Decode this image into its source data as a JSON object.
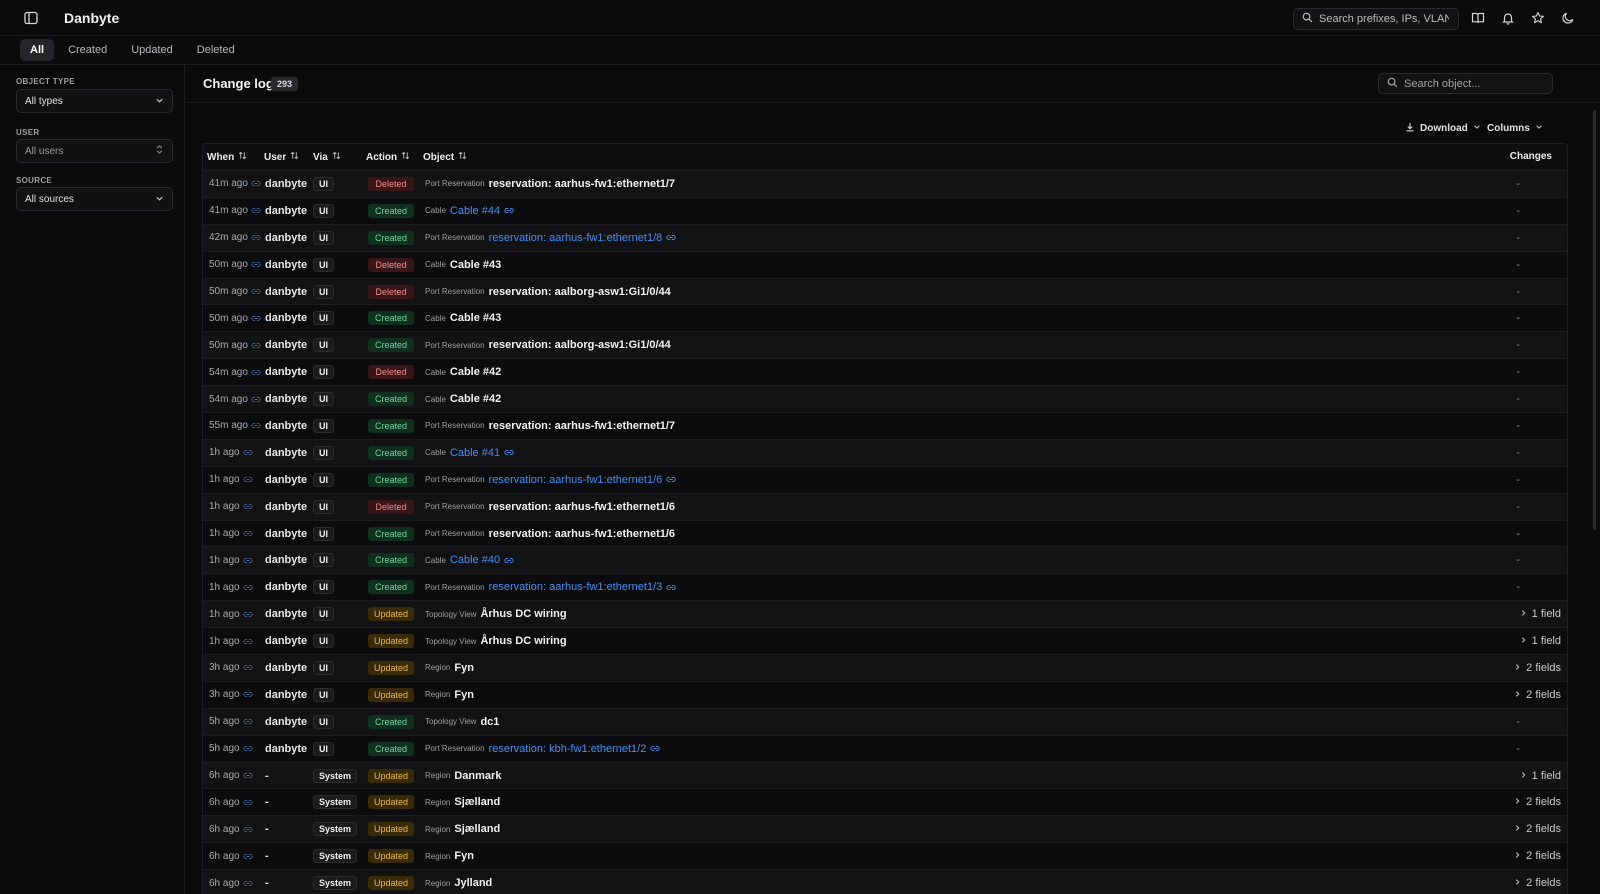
{
  "app": {
    "title": "Danbyte"
  },
  "header": {
    "search_placeholder": "Search prefixes, IPs, VLANs..."
  },
  "tabs": [
    {
      "label": "All",
      "active": true
    },
    {
      "label": "Created",
      "active": false
    },
    {
      "label": "Updated",
      "active": false
    },
    {
      "label": "Deleted",
      "active": false
    }
  ],
  "filters": {
    "object_type": {
      "label": "OBJECT TYPE",
      "value": "All types"
    },
    "user": {
      "label": "USER",
      "value": "All users"
    },
    "source": {
      "label": "SOURCE",
      "value": "All sources"
    }
  },
  "main": {
    "title": "Change log",
    "count": "293",
    "search_placeholder": "Search object...",
    "download_label": "Download",
    "columns_label": "Columns"
  },
  "table": {
    "headers": {
      "when": "When",
      "user": "User",
      "via": "Via",
      "action": "Action",
      "object": "Object",
      "changes": "Changes"
    },
    "rows": [
      {
        "when": "41m ago",
        "user": "danbyte",
        "via": "UI",
        "action": "Deleted",
        "object_type": "Port Reservation",
        "object": "reservation: aarhus-fw1:ethernet1/7",
        "link": false,
        "changes": "-"
      },
      {
        "when": "41m ago",
        "user": "danbyte",
        "via": "UI",
        "action": "Created",
        "object_type": "Cable",
        "object": "Cable #44",
        "link": true,
        "changes": "-"
      },
      {
        "when": "42m ago",
        "user": "danbyte",
        "via": "UI",
        "action": "Created",
        "object_type": "Port Reservation",
        "object": "reservation: aarhus-fw1:ethernet1/8",
        "link": true,
        "changes": "-"
      },
      {
        "when": "50m ago",
        "user": "danbyte",
        "via": "UI",
        "action": "Deleted",
        "object_type": "Cable",
        "object": "Cable #43",
        "link": false,
        "changes": "-"
      },
      {
        "when": "50m ago",
        "user": "danbyte",
        "via": "UI",
        "action": "Deleted",
        "object_type": "Port Reservation",
        "object": "reservation: aalborg-asw1:Gi1/0/44",
        "link": false,
        "changes": "-"
      },
      {
        "when": "50m ago",
        "user": "danbyte",
        "via": "UI",
        "action": "Created",
        "object_type": "Cable",
        "object": "Cable #43",
        "link": false,
        "changes": "-"
      },
      {
        "when": "50m ago",
        "user": "danbyte",
        "via": "UI",
        "action": "Created",
        "object_type": "Port Reservation",
        "object": "reservation: aalborg-asw1:Gi1/0/44",
        "link": false,
        "changes": "-"
      },
      {
        "when": "54m ago",
        "user": "danbyte",
        "via": "UI",
        "action": "Deleted",
        "object_type": "Cable",
        "object": "Cable #42",
        "link": false,
        "changes": "-"
      },
      {
        "when": "54m ago",
        "user": "danbyte",
        "via": "UI",
        "action": "Created",
        "object_type": "Cable",
        "object": "Cable #42",
        "link": false,
        "changes": "-"
      },
      {
        "when": "55m ago",
        "user": "danbyte",
        "via": "UI",
        "action": "Created",
        "object_type": "Port Reservation",
        "object": "reservation: aarhus-fw1:ethernet1/7",
        "link": false,
        "changes": "-"
      },
      {
        "when": "1h ago",
        "user": "danbyte",
        "via": "UI",
        "action": "Created",
        "object_type": "Cable",
        "object": "Cable #41",
        "link": true,
        "changes": "-"
      },
      {
        "when": "1h ago",
        "user": "danbyte",
        "via": "UI",
        "action": "Created",
        "object_type": "Port Reservation",
        "object": "reservation: aarhus-fw1:ethernet1/6",
        "link": true,
        "changes": "-"
      },
      {
        "when": "1h ago",
        "user": "danbyte",
        "via": "UI",
        "action": "Deleted",
        "object_type": "Port Reservation",
        "object": "reservation: aarhus-fw1:ethernet1/6",
        "link": false,
        "changes": "-"
      },
      {
        "when": "1h ago",
        "user": "danbyte",
        "via": "UI",
        "action": "Created",
        "object_type": "Port Reservation",
        "object": "reservation: aarhus-fw1:ethernet1/6",
        "link": false,
        "changes": "-"
      },
      {
        "when": "1h ago",
        "user": "danbyte",
        "via": "UI",
        "action": "Created",
        "object_type": "Cable",
        "object": "Cable #40",
        "link": true,
        "changes": "-"
      },
      {
        "when": "1h ago",
        "user": "danbyte",
        "via": "UI",
        "action": "Created",
        "object_type": "Port Reservation",
        "object": "reservation: aarhus-fw1:ethernet1/3",
        "link": true,
        "changes": "-"
      },
      {
        "when": "1h ago",
        "user": "danbyte",
        "via": "UI",
        "action": "Updated",
        "object_type": "Topology View",
        "object": "Århus DC wiring",
        "link": false,
        "changes": "1 field"
      },
      {
        "when": "1h ago",
        "user": "danbyte",
        "via": "UI",
        "action": "Updated",
        "object_type": "Topology View",
        "object": "Århus DC wiring",
        "link": false,
        "changes": "1 field"
      },
      {
        "when": "3h ago",
        "user": "danbyte",
        "via": "UI",
        "action": "Updated",
        "object_type": "Region",
        "object": "Fyn",
        "link": false,
        "changes": "2 fields"
      },
      {
        "when": "3h ago",
        "user": "danbyte",
        "via": "UI",
        "action": "Updated",
        "object_type": "Region",
        "object": "Fyn",
        "link": false,
        "changes": "2 fields"
      },
      {
        "when": "5h ago",
        "user": "danbyte",
        "via": "UI",
        "action": "Created",
        "object_type": "Topology View",
        "object": "dc1",
        "link": false,
        "changes": "-"
      },
      {
        "when": "5h ago",
        "user": "danbyte",
        "via": "UI",
        "action": "Created",
        "object_type": "Port Reservation",
        "object": "reservation: kbh-fw1:ethernet1/2",
        "link": true,
        "changes": "-"
      },
      {
        "when": "6h ago",
        "user": "-",
        "via": "System",
        "action": "Updated",
        "object_type": "Region",
        "object": "Danmark",
        "link": false,
        "changes": "1 field"
      },
      {
        "when": "6h ago",
        "user": "-",
        "via": "System",
        "action": "Updated",
        "object_type": "Region",
        "object": "Sjælland",
        "link": false,
        "changes": "2 fields"
      },
      {
        "when": "6h ago",
        "user": "-",
        "via": "System",
        "action": "Updated",
        "object_type": "Region",
        "object": "Sjælland",
        "link": false,
        "changes": "2 fields"
      },
      {
        "when": "6h ago",
        "user": "-",
        "via": "System",
        "action": "Updated",
        "object_type": "Region",
        "object": "Fyn",
        "link": false,
        "changes": "2 fields"
      },
      {
        "when": "6h ago",
        "user": "-",
        "via": "System",
        "action": "Updated",
        "object_type": "Region",
        "object": "Jylland",
        "link": false,
        "changes": "2 fields"
      }
    ]
  },
  "colors": {
    "background": "#0b0b0c",
    "link": "#4a8cf2",
    "deleted": "#f08b8b",
    "created": "#6ed79a",
    "updated": "#e9b949"
  },
  "icons": [
    "sidebar-toggle-icon",
    "search-icon",
    "book-icon",
    "bell-icon",
    "star-icon",
    "moon-icon",
    "chevron-down-icon",
    "chevron-updown-icon",
    "download-icon",
    "sort-icon",
    "link-icon",
    "chevron-right-icon"
  ]
}
